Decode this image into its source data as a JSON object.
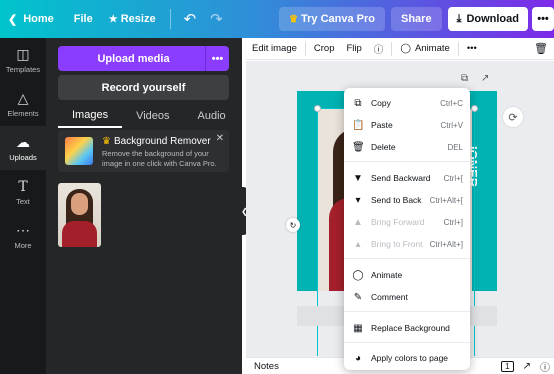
{
  "topbar": {
    "home": "Home",
    "file": "File",
    "resize": "Resize",
    "try_pro": "Try Canva Pro",
    "share": "Share",
    "download": "Download",
    "more": "•••"
  },
  "rail": {
    "items": [
      {
        "label": "Templates"
      },
      {
        "label": "Elements"
      },
      {
        "label": "Uploads"
      },
      {
        "label": "Text"
      },
      {
        "label": "More"
      }
    ]
  },
  "panel": {
    "upload_media": "Upload media",
    "upload_more": "•••",
    "record_yourself": "Record yourself",
    "tabs": [
      {
        "label": "Images"
      },
      {
        "label": "Videos"
      },
      {
        "label": "Audio"
      }
    ],
    "promo": {
      "title": "Background Remover",
      "desc": "Remove the background of your image in one click with Canva Pro."
    }
  },
  "editor_toolbar": {
    "edit_image": "Edit image",
    "crop": "Crop",
    "flip": "Flip",
    "animate": "Animate",
    "more": "•••"
  },
  "canvas": {
    "design_text": "IONER"
  },
  "bottombar": {
    "notes": "Notes",
    "page": "1"
  },
  "context_menu": {
    "items": [
      {
        "label": "Copy",
        "shortcut": "Ctrl+C",
        "icon": "copy-icon"
      },
      {
        "label": "Paste",
        "shortcut": "Ctrl+V",
        "icon": "paste-icon"
      },
      {
        "label": "Delete",
        "shortcut": "DEL",
        "icon": "trash-icon"
      },
      {
        "label": "Send Backward",
        "shortcut": "Ctrl+[",
        "icon": "send-backward-icon"
      },
      {
        "label": "Send to Back",
        "shortcut": "Ctrl+Alt+[",
        "icon": "send-to-back-icon"
      },
      {
        "label": "Bring Forward",
        "shortcut": "Ctrl+]",
        "icon": "bring-forward-icon"
      },
      {
        "label": "Bring to Front",
        "shortcut": "Ctrl+Alt+]",
        "icon": "bring-to-front-icon"
      },
      {
        "label": "Animate",
        "shortcut": "",
        "icon": "animate-icon"
      },
      {
        "label": "Comment",
        "shortcut": "",
        "icon": "comment-icon"
      },
      {
        "label": "Replace Background",
        "shortcut": "",
        "icon": "replace-background-icon"
      },
      {
        "label": "Apply colors to page",
        "shortcut": "",
        "icon": "palette-icon"
      }
    ]
  }
}
